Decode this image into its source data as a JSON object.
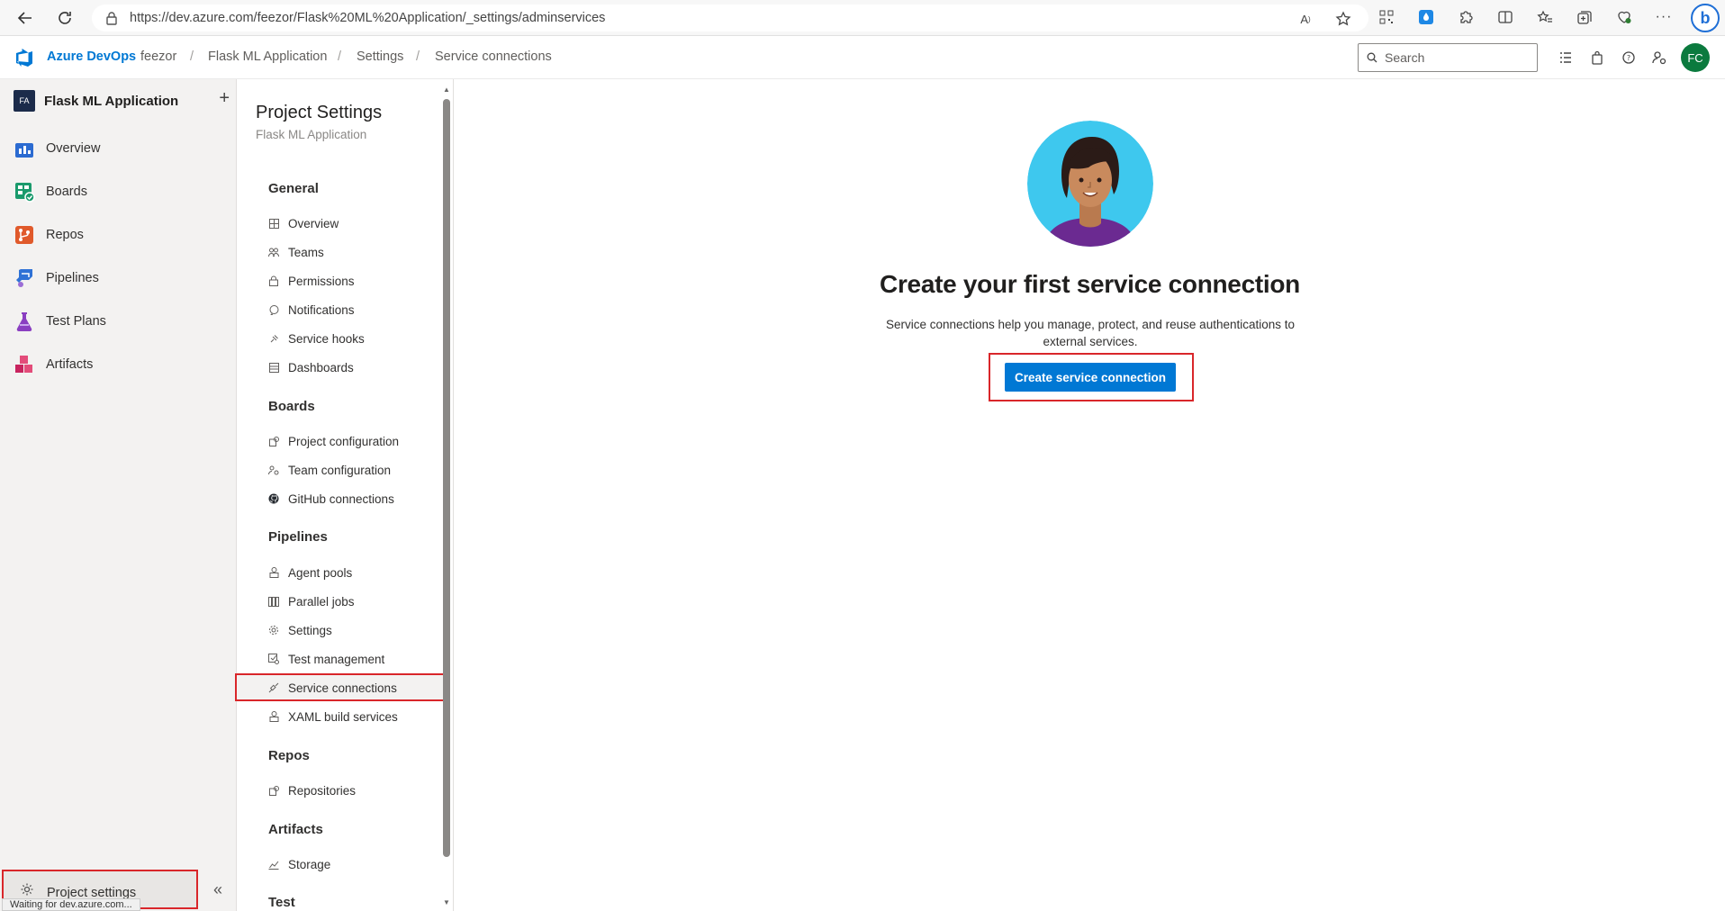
{
  "browser": {
    "url": "https://dev.azure.com/feezor/Flask%20ML%20Application/_settings/adminservices"
  },
  "header": {
    "brand": "Azure DevOps",
    "breadcrumbs": [
      "feezor",
      "Flask ML Application",
      "Settings",
      "Service connections"
    ],
    "search_placeholder": "Search",
    "avatar_initials": "FC"
  },
  "leftnav": {
    "project_badge": "FA",
    "project_name": "Flask ML Application",
    "add_symbol": "+",
    "items": [
      {
        "label": "Overview",
        "icon": "overview-icon"
      },
      {
        "label": "Boards",
        "icon": "boards-icon"
      },
      {
        "label": "Repos",
        "icon": "repos-icon"
      },
      {
        "label": "Pipelines",
        "icon": "pipelines-icon"
      },
      {
        "label": "Test Plans",
        "icon": "test-plans-icon"
      },
      {
        "label": "Artifacts",
        "icon": "artifacts-icon"
      }
    ],
    "project_settings": "Project settings",
    "status_text": "Waiting for dev.azure.com..."
  },
  "settings": {
    "title": "Project Settings",
    "subtitle": "Flask ML Application",
    "sections": {
      "general": {
        "heading": "General",
        "items": [
          "Overview",
          "Teams",
          "Permissions",
          "Notifications",
          "Service hooks",
          "Dashboards"
        ]
      },
      "boards": {
        "heading": "Boards",
        "items": [
          "Project configuration",
          "Team configuration",
          "GitHub connections"
        ]
      },
      "pipelines": {
        "heading": "Pipelines",
        "items": [
          "Agent pools",
          "Parallel jobs",
          "Settings",
          "Test management",
          "Service connections",
          "XAML build services"
        ]
      },
      "repos": {
        "heading": "Repos",
        "items": [
          "Repositories"
        ]
      },
      "artifacts": {
        "heading": "Artifacts",
        "items": [
          "Storage"
        ]
      },
      "test": {
        "heading": "Test"
      }
    },
    "selected": "Service connections"
  },
  "main": {
    "headline": "Create your first service connection",
    "description": "Service connections help you manage, protect, and reuse authentications to external services.",
    "cta_label": "Create service connection"
  },
  "colors": {
    "accent": "#0078d4",
    "highlight_box": "#d9262a",
    "avatar_bg": "#0b7a3e"
  }
}
